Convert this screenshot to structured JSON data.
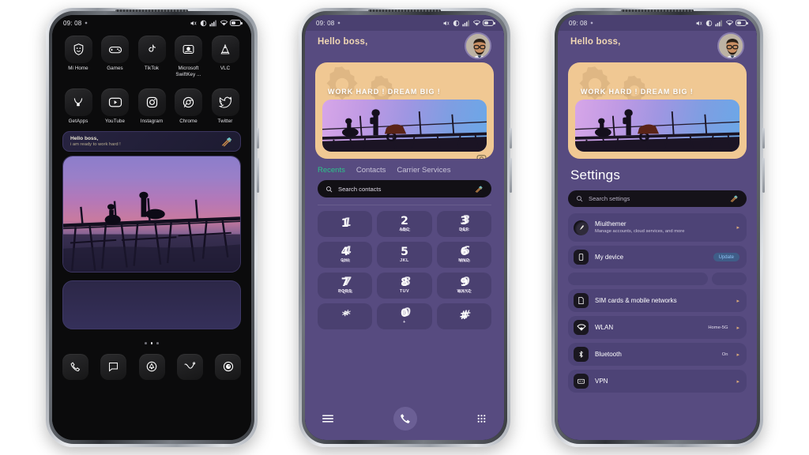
{
  "status_bar": {
    "time": "09: 08",
    "icons": [
      "mute-icon",
      "dnd-icon",
      "signal-icon",
      "wifi-icon",
      "battery-icon"
    ]
  },
  "phone1": {
    "apps_row1": [
      {
        "label": "Mi Home",
        "icon": "mi-home-icon"
      },
      {
        "label": "Games",
        "icon": "gamepad-icon"
      },
      {
        "label": "TikTok",
        "icon": "tiktok-icon"
      },
      {
        "label": "Microsoft SwiftKey ...",
        "icon": "swiftkey-icon"
      },
      {
        "label": "VLC",
        "icon": "vlc-cone-icon"
      }
    ],
    "apps_row2": [
      {
        "label": "GetApps",
        "icon": "getapps-icon"
      },
      {
        "label": "YouTube",
        "icon": "youtube-icon"
      },
      {
        "label": "Instagram",
        "icon": "instagram-icon"
      },
      {
        "label": "Chrome",
        "icon": "chrome-icon"
      },
      {
        "label": "Twitter",
        "icon": "twitter-icon"
      }
    ],
    "note_widget": {
      "title": "Hello boss,",
      "subtitle": "i am ready to work hard !",
      "icon": "hammer-tools-icon"
    },
    "page_dots": {
      "count": 3,
      "active_index": 1
    },
    "dock": [
      {
        "icon": "phone-icon"
      },
      {
        "icon": "messages-icon"
      },
      {
        "icon": "app-drawer-icon"
      },
      {
        "icon": "share-icon"
      },
      {
        "icon": "camera-icon"
      }
    ]
  },
  "banner": {
    "greeting": "Hello boss,",
    "slogan": "WORK HARD ! DREAM BIG !",
    "avatar": "user-avatar",
    "camera_badge": "camera-badge-icon"
  },
  "phone2": {
    "tabs": [
      {
        "label": "Recents",
        "active": true
      },
      {
        "label": "Contacts",
        "active": false
      },
      {
        "label": "Carrier Services",
        "active": false
      }
    ],
    "search": {
      "placeholder": "Search contacts",
      "icon": "search-icon",
      "theme_icon": "hammer-tools-icon"
    },
    "keypad": [
      {
        "num": "1",
        "sub": ""
      },
      {
        "num": "2",
        "sub": "ABC"
      },
      {
        "num": "3",
        "sub": "DEF"
      },
      {
        "num": "4",
        "sub": "GHI"
      },
      {
        "num": "5",
        "sub": "JKL"
      },
      {
        "num": "6",
        "sub": "MNO"
      },
      {
        "num": "7",
        "sub": "PQRS"
      },
      {
        "num": "8",
        "sub": "TUV"
      },
      {
        "num": "9",
        "sub": "WXYZ"
      },
      {
        "num": "*",
        "sub": ""
      },
      {
        "num": "0",
        "sub": "+"
      },
      {
        "num": "#",
        "sub": ""
      }
    ],
    "bottom_bar": {
      "menu": "menu-icon",
      "call": "call-button",
      "dialpad": "dialpad-icon"
    }
  },
  "phone3": {
    "title": "Settings",
    "search": {
      "placeholder": "Search settings",
      "icon": "search-icon",
      "theme_icon": "hammer-tools-icon"
    },
    "rows": [
      {
        "name": "Miuithemer",
        "sub": "Manage accounts, cloud services, and more",
        "value": "",
        "badge": "",
        "icon": "account-avatar-icon",
        "chevron": true
      },
      {
        "name": "My device",
        "sub": "",
        "value": "",
        "badge": "Update",
        "icon": "device-icon",
        "chevron": false
      },
      {
        "name": "SIM cards & mobile networks",
        "sub": "",
        "value": "",
        "badge": "",
        "icon": "sim-card-icon",
        "chevron": true
      },
      {
        "name": "WLAN",
        "sub": "",
        "value": "Home-5G",
        "badge": "",
        "icon": "wifi-icon",
        "chevron": true
      },
      {
        "name": "Bluetooth",
        "sub": "",
        "value": "On",
        "badge": "",
        "icon": "bluetooth-icon",
        "chevron": true
      },
      {
        "name": "VPN",
        "sub": "",
        "value": "",
        "badge": "",
        "icon": "vpn-icon",
        "chevron": true
      }
    ]
  },
  "colors": {
    "purple_bg": "#574b80",
    "row_bg": "#4d4376",
    "banner_bg": "#f0c893",
    "accent_green": "#2bc48a",
    "chevron": "#d9a97a",
    "badge_text": "#8fc3f5"
  }
}
